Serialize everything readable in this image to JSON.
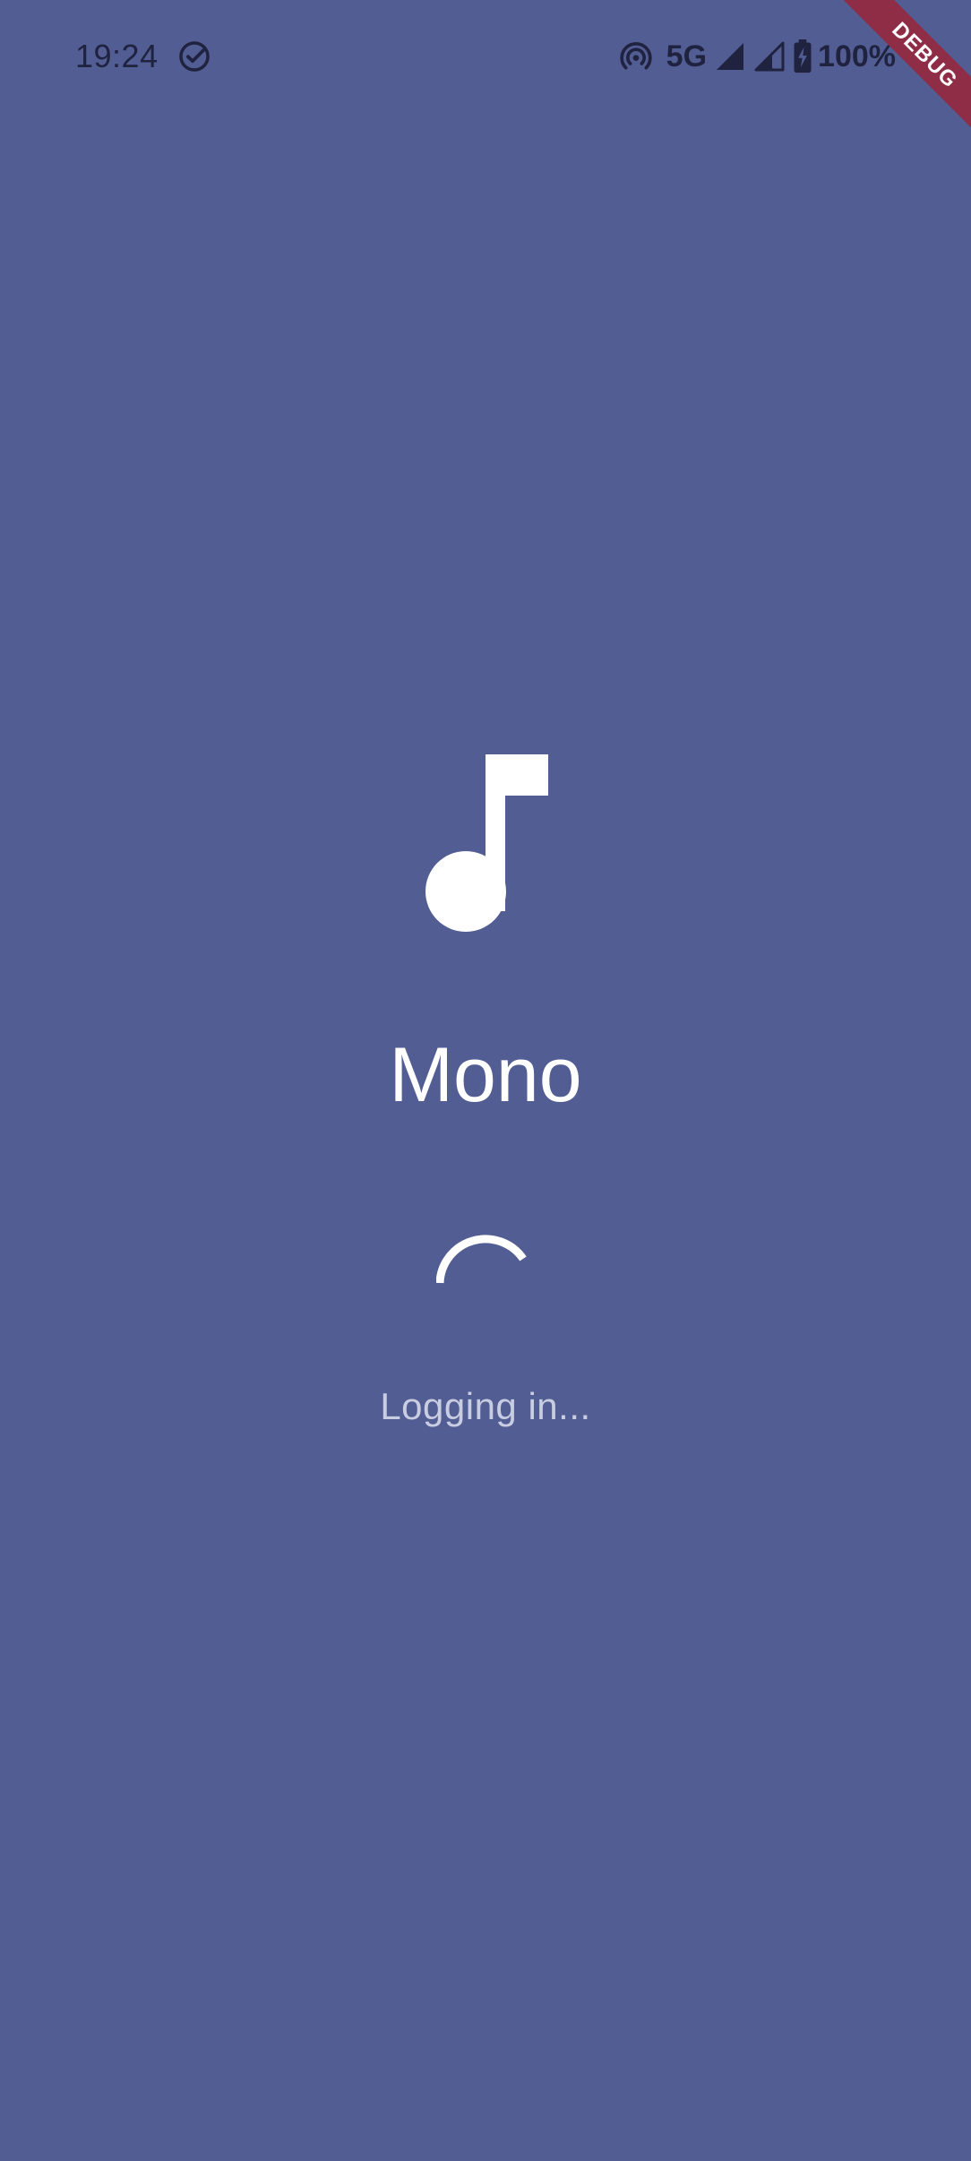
{
  "status_bar": {
    "time": "19:24",
    "network": "5G",
    "battery": "100%"
  },
  "debug_banner": "DEBUG",
  "app": {
    "title": "Mono",
    "status_message": "Logging in..."
  },
  "colors": {
    "background": "#525d93",
    "accent": "#ffffff",
    "muted_text": "#c9cde2",
    "status_icons": "#1f2340",
    "debug_ribbon": "#8e2d45"
  },
  "icons": {
    "app_logo": "music-note-icon",
    "loading": "spinner"
  }
}
